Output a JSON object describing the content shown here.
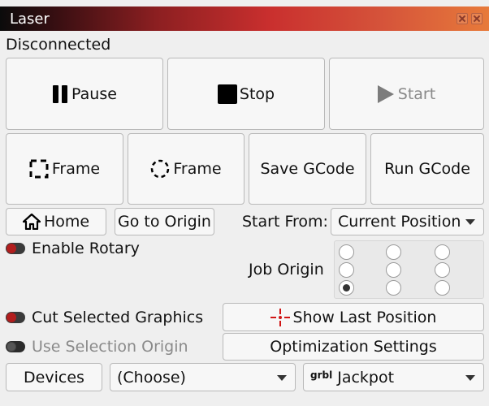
{
  "window": {
    "title": "Laser"
  },
  "status": "Disconnected",
  "buttons": {
    "pause": "Pause",
    "stop": "Stop",
    "start": "Start",
    "frame_rect": "Frame",
    "frame_round": "Frame",
    "save_gcode": "Save GCode",
    "run_gcode": "Run GCode",
    "home": "Home",
    "go_to_origin": "Go to Origin",
    "show_last_position": "Show Last Position",
    "optimization_settings": "Optimization Settings",
    "devices": "Devices"
  },
  "start_from": {
    "label": "Start From:",
    "value": "Current Position"
  },
  "toggles": {
    "enable_rotary": "Enable Rotary",
    "cut_selected_graphics": "Cut Selected Graphics",
    "use_selection_origin": "Use Selection Origin"
  },
  "job_origin": {
    "label": "Job Origin",
    "selected": "bottom-left"
  },
  "device_select": {
    "value": "(Choose)"
  },
  "profile_select": {
    "prefix": "grbl",
    "value": "Jackpot"
  },
  "colors": {
    "accent": "#b11d1d",
    "title_gradient_start": "#0b0b0b",
    "title_gradient_end": "#e77a3a"
  }
}
